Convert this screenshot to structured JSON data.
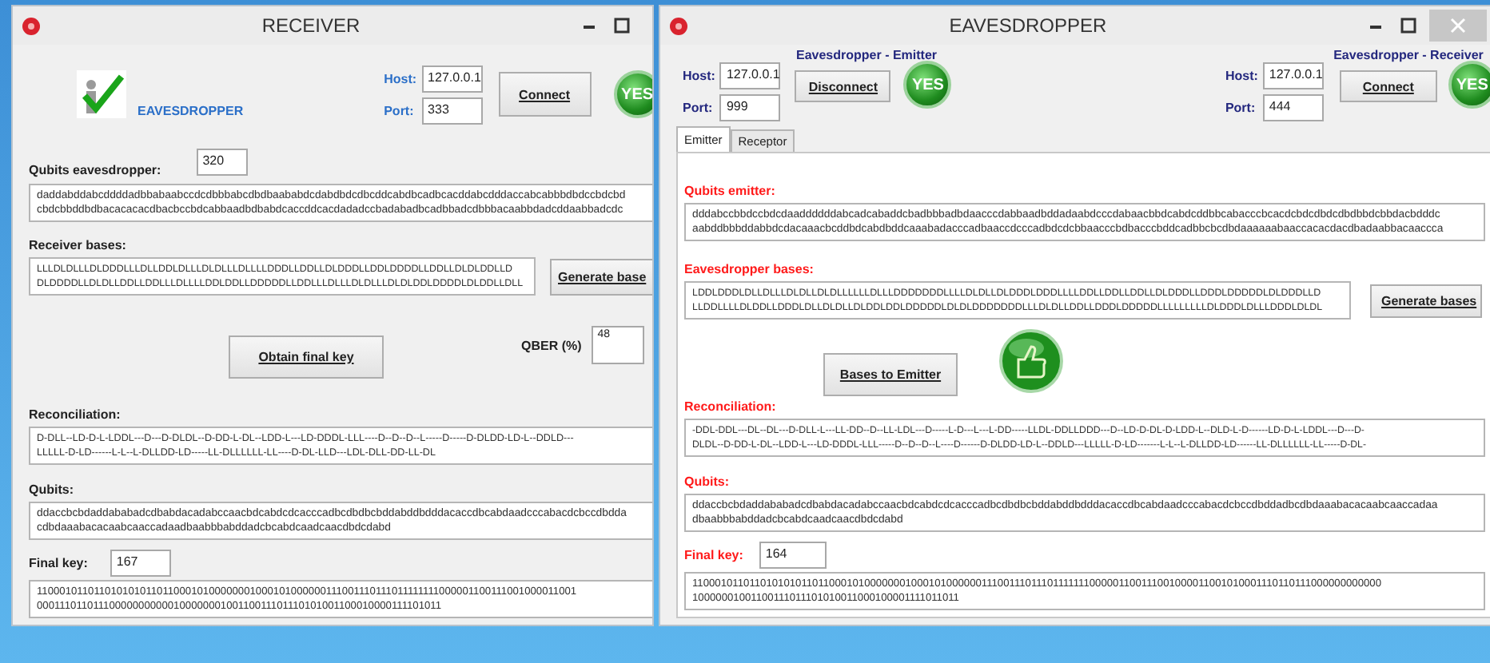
{
  "receiver": {
    "title": "RECEIVER",
    "logo_label": "EAVESDROPPER",
    "host_label": "Host:",
    "host": "127.0.0.1",
    "port_label": "Port:",
    "port": "333",
    "connect_button": "Connect",
    "status_badge": "YES",
    "qubits_label": "Qubits eavesdropper:",
    "qubits_count": "320",
    "qubits_lines": [
      "daddabddabcddddadbbabaabccdcdbbbabcdbdbaababdcdabdbdcdbcddcabdbcadbcacddabcdddaccabcabbbdbdccbdcbd",
      "cbdcbbddbdbacacacacdbacbccbdcabbaadbdbabdcaccddcacdadadccbadabadbcadbbadcdbbbacaabbdadcddaabbadcdc"
    ],
    "bases_label": "Receiver bases:",
    "bases_lines": [
      "LLLDLDLLLDLDDDLLLDLLDDLDLLLDLDLLLDLLLLDDDLLDDLLDLDDDLLDDLDDDDLLDDLLDLDLDDLLD",
      "DLDDDDLLDLDLLDDLLDDLLLDLLLLDDLDDLLDDDDDLLDDLLLDLLLDLDLLLDLDLDDLDDDDLDLDDLLDLL"
    ],
    "generate_button": "Generate base",
    "obtain_button": "Obtain final key",
    "qber_label": "QBER (%)",
    "qber": "48",
    "reconciliation_label": "Reconciliation:",
    "reconciliation_lines": [
      "D-DLL--LD-D-L-LDDL---D---D-DLDL--D-DD-L-DL--LDD-L---LD-DDDL-LLL----D--D--D--L-----D-----D-DLDD-LD-L--DDLD---",
      "LLLLL-D-LD------L-L--L-DLLDD-LD-----LL-DLLLLLL-LL----D-DL-LLD---LDL-DLL-DD-LL-DL"
    ],
    "qubits2_label": "Qubits:",
    "qubits2_lines": [
      "ddaccbcbdaddababadcdbabdacadabccaacbdcabdcdcacccadbcdbdbcbddabddbdddacaccdbcabdaadcccabacdcbccdbdda",
      "cdbdaaabacacaabcaaccadaadbaabbbabddadcbcabdcaadcaacdbdcdabd"
    ],
    "final_key_label": "Final key:",
    "final_key_count": "167",
    "final_key_lines": [
      "11000101101101010101101100010100000001000101000000111001110111011111111000001100111001000011001",
      "00011101101110000000000010000000100110011101110101001100010000111101011"
    ]
  },
  "eavesdropper": {
    "title": "EAVESDROPPER",
    "emitter_heading": "Eavesdropper - Emitter",
    "receiver_heading": "Eavesdropper - Receiver",
    "left_host_label": "Host:",
    "left_host": "127.0.0.1",
    "left_port_label": "Port:",
    "left_port": "999",
    "disconnect_button": "Disconnect",
    "left_status_badge": "YES",
    "right_host_label": "Host:",
    "right_host": "127.0.0.1",
    "right_port_label": "Port:",
    "right_port": "444",
    "connect_button": "Connect",
    "right_status_badge": "YES",
    "tabs": [
      {
        "label": "Emitter",
        "selected": true
      },
      {
        "label": "Receptor",
        "selected": false
      }
    ],
    "qubits_label": "Qubits emitter:",
    "qubits_lines": [
      "dddabccbbdccbdcdaaddddddabcadcabaddcbadbbbadbdaacccdabbaadbddadaabdcccdabaacbbdcabdcddbbcabacccbcacdcbdcdbdcdbdbbdcbbdacbdddc",
      "aabddbbbddabbdcdacaaacbcddbdcabdbddcaaabadacccadbaaccdcccadbdcdcbbaacccbdbacccbddcadbbcbcdbdaaaaaabaaccacacdacdbadaabbacaaccca"
    ],
    "bases_label": "Eavesdropper bases:",
    "bases_lines": [
      "LDDLDDDLDLLDLLLDLDLLDLDLLLLLLDLLLDDDDDDDLLLLDLDLLDLDDDLDDDLLLLDDLLDDLLDDLLDLDDDLLDDDLDDDDDLDLDDDLLD",
      "LLDDLLLLDLDDLLDDDLDLLDLDLLDLDDLDDLDDDDDLDLDLDDDDDDDLLLDLDLLDDLLDDDLDDDDDLLLLLLLLLDLDDDLDLLLDDDLDLDL"
    ],
    "generate_button": "Generate bases",
    "bases_to_emitter_button": "Bases to Emitter",
    "reconciliation_label": "Reconciliation:",
    "reconciliation_lines": [
      "-DDL-DDL---DL--DL---D-DLL-L---LL-DD--D--LL-LDL---D-----L-D---L---L-DD-----LLDL-DDLLDDD---D--LD-D-DL-D-LDD-L--DLD-L-D------LD-D-L-LDDL---D---D-",
      "DLDL--D-DD-L-DL--LDD-L---LD-DDDL-LLL-----D--D--D--L----D------D-DLDD-LD-L--DDLD---LLLLL-D-LD-------L-L--L-DLLDD-LD------LL-DLLLLLL-LL-----D-DL-"
    ],
    "qubits2_label": "Qubits:",
    "qubits2_lines": [
      "ddaccbcbdaddababadcdbabdacadabccaacbdcabdcdcacccadbcdbdbcbddabddbdddacaccdbcabdaadcccabacdcbccdbddadbcdbdaaabacacaabcaaccadaa",
      "dbaabbbabddadcbcabdcaadcaacdbdcdabd"
    ],
    "final_key_label": "Final key:",
    "final_key_count": "164",
    "final_key_lines": [
      "1100010110110101010110110001010000000100010100000011100111011101111111000001100111001000011001010001110110111000000000000",
      "10000001001100111011101010011000100001111011011"
    ]
  }
}
